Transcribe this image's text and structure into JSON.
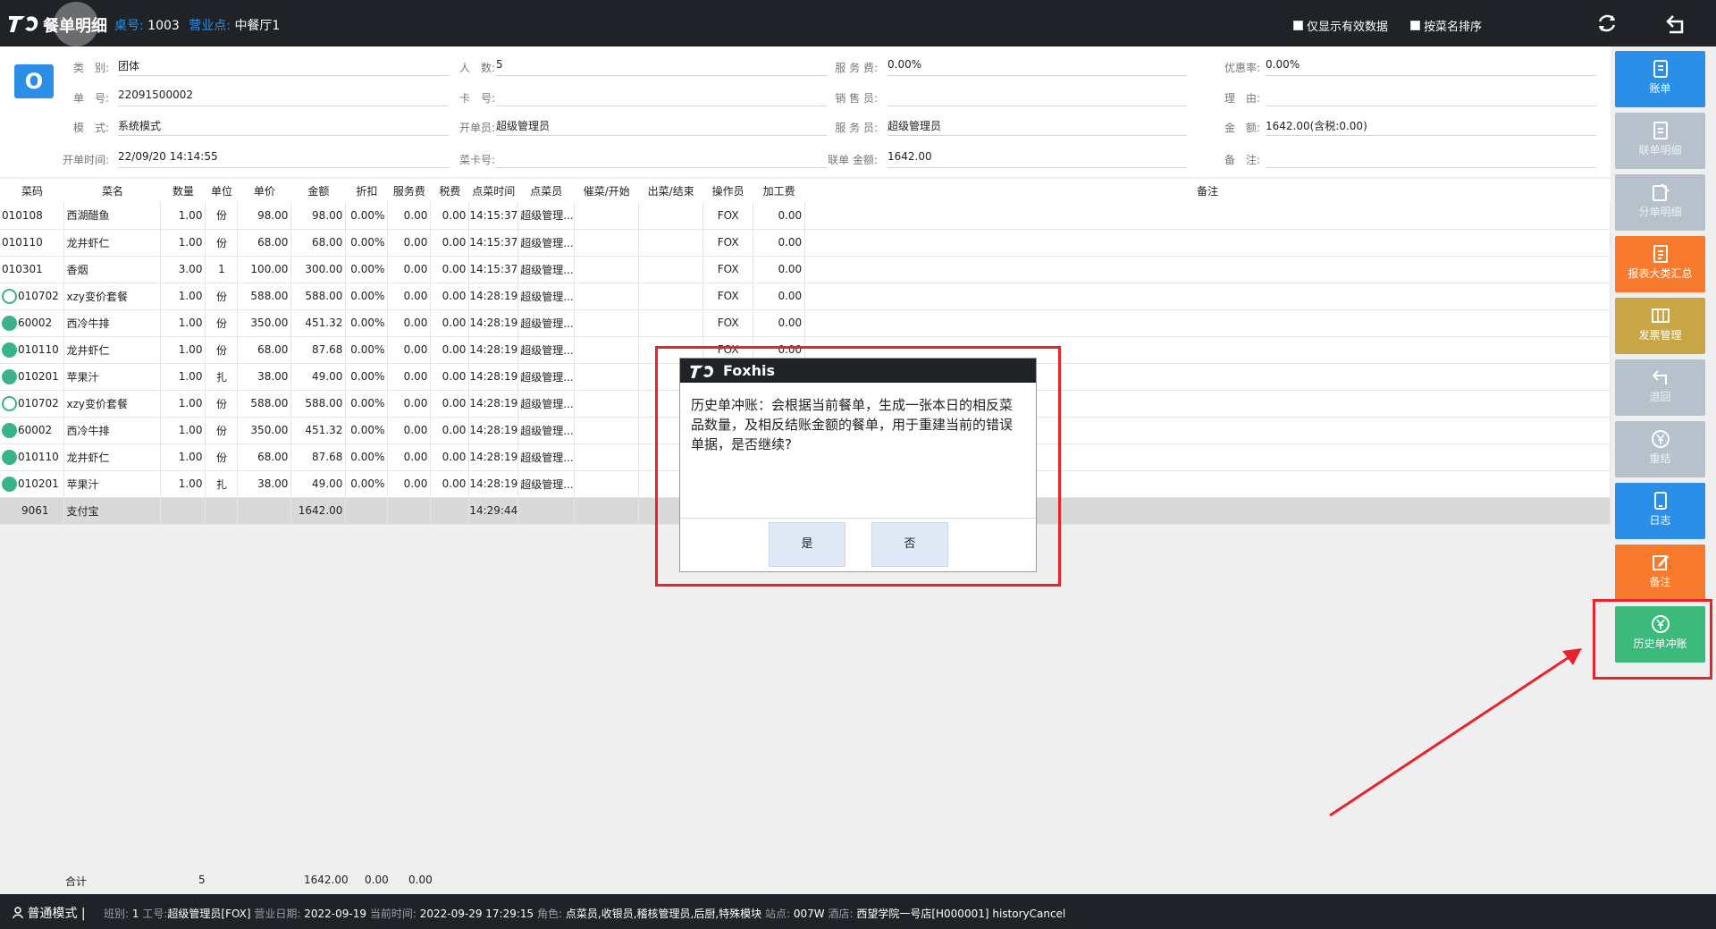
{
  "header": {
    "app_title": "餐单明细",
    "table_label": "桌号:",
    "table_value": "1003",
    "outlet_label": "营业点:",
    "outlet_value": "中餐厅1",
    "chk_valid": "仅显示有效数据",
    "chk_sort": "按菜名排序"
  },
  "order": {
    "badge": "O",
    "fields": [
      {
        "label": "类　别:",
        "value": "团体"
      },
      {
        "label": "人　数:",
        "value": "5"
      },
      {
        "label": "服 务 费:",
        "value": "0.00%"
      },
      {
        "label": "优惠率:",
        "value": "0.00%"
      },
      {
        "label": "单　号:",
        "value": "22091500002"
      },
      {
        "label": "卡　号:",
        "value": ""
      },
      {
        "label": "销 售 员:",
        "value": ""
      },
      {
        "label": "理　由:",
        "value": ""
      },
      {
        "label": "模　式:",
        "value": "系统模式"
      },
      {
        "label": "开单员:",
        "value": "超级管理员"
      },
      {
        "label": "服 务 员:",
        "value": "超级管理员"
      },
      {
        "label": "金　额:",
        "value": "1642.00(含税:0.00)"
      },
      {
        "label": "开单时间:",
        "value": "22/09/20 14:14:55"
      },
      {
        "label": "菜卡号:",
        "value": ""
      },
      {
        "label": "联单 金额:",
        "value": "1642.00"
      },
      {
        "label": "备　注:",
        "value": ""
      }
    ]
  },
  "table": {
    "headers": [
      "菜码",
      "菜名",
      "数量",
      "单位",
      "单价",
      "金额",
      "折扣",
      "服务费",
      "税费",
      "点菜时间",
      "点菜员",
      "催菜/开始",
      "出菜/结束",
      "操作员",
      "加工费",
      "备注"
    ],
    "rows": [
      {
        "icon": "",
        "code": "010108",
        "name": "西湖醋鱼",
        "qty": "1.00",
        "unit": "份",
        "price": "98.00",
        "amount": "98.00",
        "disc": "0.00%",
        "svc": "0.00",
        "tax": "0.00",
        "time": "14:15:37",
        "waiter": "超级管理...",
        "op": "FOX",
        "fee": "0.00"
      },
      {
        "icon": "",
        "code": "010110",
        "name": "龙井虾仁",
        "qty": "1.00",
        "unit": "份",
        "price": "68.00",
        "amount": "68.00",
        "disc": "0.00%",
        "svc": "0.00",
        "tax": "0.00",
        "time": "14:15:37",
        "waiter": "超级管理...",
        "op": "FOX",
        "fee": "0.00"
      },
      {
        "icon": "",
        "code": "010301",
        "name": "香烟",
        "qty": "3.00",
        "unit": "1",
        "price": "100.00",
        "amount": "300.00",
        "disc": "0.00%",
        "svc": "0.00",
        "tax": "0.00",
        "time": "14:15:37",
        "waiter": "超级管理...",
        "op": "FOX",
        "fee": "0.00"
      },
      {
        "icon": "ring",
        "code": "010702",
        "name": "xzy变价套餐",
        "qty": "1.00",
        "unit": "份",
        "price": "588.00",
        "amount": "588.00",
        "disc": "0.00%",
        "svc": "0.00",
        "tax": "0.00",
        "time": "14:28:19",
        "waiter": "超级管理...",
        "op": "FOX",
        "fee": "0.00"
      },
      {
        "icon": "green",
        "code": "60002",
        "name": "西冷牛排",
        "qty": "1.00",
        "unit": "份",
        "price": "350.00",
        "amount": "451.32",
        "disc": "0.00%",
        "svc": "0.00",
        "tax": "0.00",
        "time": "14:28:19",
        "waiter": "超级管理...",
        "op": "FOX",
        "fee": "0.00"
      },
      {
        "icon": "green",
        "code": "010110",
        "name": "龙井虾仁",
        "qty": "1.00",
        "unit": "份",
        "price": "68.00",
        "amount": "87.68",
        "disc": "0.00%",
        "svc": "0.00",
        "tax": "0.00",
        "time": "14:28:19",
        "waiter": "超级管理...",
        "op": "FOX",
        "fee": "0.00"
      },
      {
        "icon": "green",
        "code": "010201",
        "name": "苹果汁",
        "qty": "1.00",
        "unit": "扎",
        "price": "38.00",
        "amount": "49.00",
        "disc": "0.00%",
        "svc": "0.00",
        "tax": "0.00",
        "time": "14:28:19",
        "waiter": "超级管理...",
        "op": "",
        "fee": ""
      },
      {
        "icon": "ring",
        "code": "010702",
        "name": "xzy变价套餐",
        "qty": "1.00",
        "unit": "份",
        "price": "588.00",
        "amount": "588.00",
        "disc": "0.00%",
        "svc": "0.00",
        "tax": "0.00",
        "time": "14:28:19",
        "waiter": "超级管理...",
        "op": "",
        "fee": ""
      },
      {
        "icon": "green",
        "code": "60002",
        "name": "西冷牛排",
        "qty": "1.00",
        "unit": "份",
        "price": "350.00",
        "amount": "451.32",
        "disc": "0.00%",
        "svc": "0.00",
        "tax": "0.00",
        "time": "14:28:19",
        "waiter": "超级管理...",
        "op": "",
        "fee": ""
      },
      {
        "icon": "green",
        "code": "010110",
        "name": "龙井虾仁",
        "qty": "1.00",
        "unit": "份",
        "price": "68.00",
        "amount": "87.68",
        "disc": "0.00%",
        "svc": "0.00",
        "tax": "0.00",
        "time": "14:28:19",
        "waiter": "超级管理...",
        "op": "",
        "fee": ""
      },
      {
        "icon": "green",
        "code": "010201",
        "name": "苹果汁",
        "qty": "1.00",
        "unit": "扎",
        "price": "38.00",
        "amount": "49.00",
        "disc": "0.00%",
        "svc": "0.00",
        "tax": "0.00",
        "time": "14:28:19",
        "waiter": "超级管理...",
        "op": "",
        "fee": ""
      }
    ],
    "payment": {
      "code": "9061",
      "name": "支付宝",
      "amount": "1642.00",
      "time": "14:29:44"
    },
    "summary": {
      "label": "合计",
      "qty": "5",
      "amount": "1642.00",
      "disc": "0.00",
      "svc": "0.00"
    }
  },
  "sidebar": {
    "buttons": [
      {
        "label": "账单",
        "color": "#2b8fe8",
        "icon": "bill-icon"
      },
      {
        "label": "联单明细",
        "color": "#b7c1cb",
        "icon": "document-icon"
      },
      {
        "label": "分单明细",
        "color": "#b7c1cb",
        "icon": "split-bill-icon"
      },
      {
        "label": "报表大类汇总",
        "color": "#f87a2c",
        "icon": "report-icon"
      },
      {
        "label": "发票管理",
        "color": "#c8a646",
        "icon": "invoice-icon"
      },
      {
        "label": "退回",
        "color": "#b7c1cb",
        "icon": "return-icon"
      },
      {
        "label": "重结",
        "color": "#b7c1cb",
        "icon": "yen-icon"
      },
      {
        "label": "日志",
        "color": "#2b8fe8",
        "icon": "log-icon"
      },
      {
        "label": "备注",
        "color": "#f87a2c",
        "icon": "edit-icon"
      },
      {
        "label": "历史单冲账",
        "color": "#3bba7c",
        "icon": "yen-circle-icon"
      }
    ]
  },
  "dialog": {
    "title": "Foxhis",
    "message": "历史单冲账：会根据当前餐单，生成一张本日的相反菜品数量，及相反结账金额的餐单，用于重建当前的错误单据，是否继续?",
    "yes": "是",
    "no": "否"
  },
  "status": {
    "mode": "普通模式",
    "shift_label": "班别:",
    "shift": "1",
    "staff_label": "工号:",
    "staff": "超级管理员[FOX]",
    "bizdate_label": "营业日期:",
    "bizdate": "2022-09-19",
    "now_label": "当前时间:",
    "now": "2022-09-29 17:29:15",
    "role_label": "角色:",
    "role": "点菜员,收银员,稽核管理员,后厨,特殊模块",
    "station_label": "站点:",
    "station": "007W",
    "hotel_label": "酒店:",
    "hotel": "西望学院一号店[H000001] historyCancel"
  },
  "colors": {
    "accent": "#2b8fe8",
    "highlight": "#e8232a",
    "dark_bar": "#1f2226"
  }
}
